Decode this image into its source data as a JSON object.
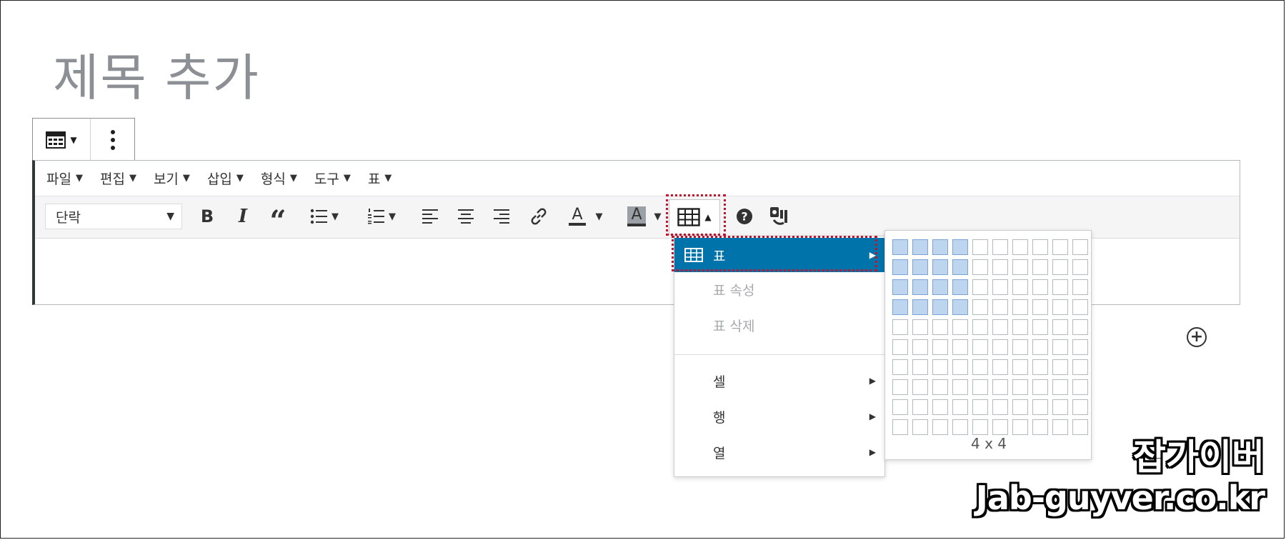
{
  "title": "제목 추가",
  "menubar": {
    "items": [
      "파일",
      "편집",
      "보기",
      "삽입",
      "형식",
      "도구",
      "표"
    ]
  },
  "toolbar": {
    "format_select": "단락"
  },
  "table_menu": {
    "items": [
      {
        "label": "표"
      },
      {
        "label": "표 속성"
      },
      {
        "label": "표 삭제"
      },
      {
        "label": "셀"
      },
      {
        "label": "행"
      },
      {
        "label": "열"
      }
    ]
  },
  "table_grid": {
    "rows": 10,
    "cols": 10,
    "selected_rows": 4,
    "selected_cols": 4,
    "size_label": "4 x 4"
  },
  "watermark": {
    "line1": "잡가이버",
    "line2": "Jab-guyver.co.kr"
  },
  "colors": {
    "accent": "#0073aa",
    "selection": "#bed5f0",
    "highlight_border": "#c0152f"
  }
}
